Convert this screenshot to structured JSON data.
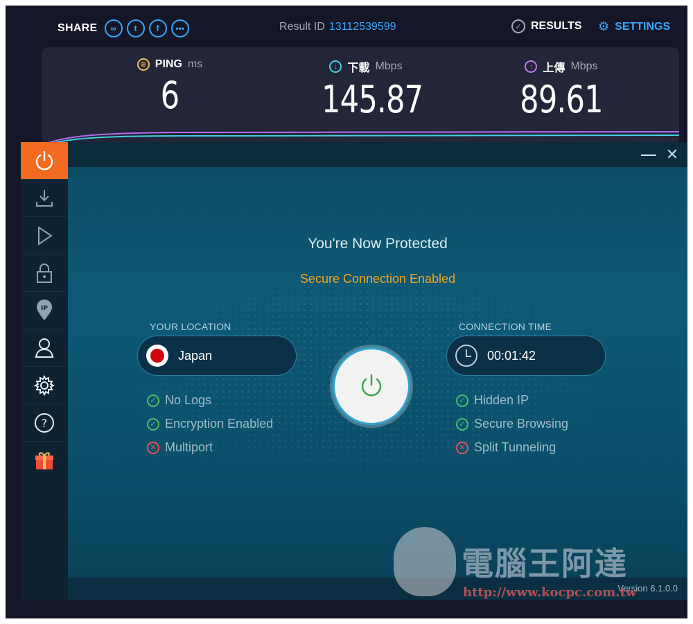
{
  "speedtest": {
    "share_label": "SHARE",
    "result_id_label": "Result ID",
    "result_id": "13112539599",
    "results_label": "RESULTS",
    "settings_label": "SETTINGS",
    "ping": {
      "label": "PING",
      "unit": "ms",
      "value": "6"
    },
    "download": {
      "label": "下載",
      "unit": "Mbps",
      "value": "145.87"
    },
    "upload": {
      "label": "上傳",
      "unit": "Mbps",
      "value": "89.61"
    }
  },
  "vpn": {
    "sidebar_icons": [
      "power-icon",
      "download-icon",
      "play-icon",
      "lock-icon",
      "ip-pin-icon",
      "user-icon",
      "gear-icon",
      "help-icon",
      "gift-icon"
    ],
    "headline": "You're Now Protected",
    "status": "Secure Connection Enabled",
    "location_label": "YOUR LOCATION",
    "location_value": "Japan",
    "time_label": "CONNECTION TIME",
    "time_value": "00:01:42",
    "left_features": [
      {
        "label": "No Logs",
        "enabled": true
      },
      {
        "label": "Encryption Enabled",
        "enabled": true
      },
      {
        "label": "Multiport",
        "enabled": false
      }
    ],
    "right_features": [
      {
        "label": "Hidden IP",
        "enabled": true
      },
      {
        "label": "Secure Browsing",
        "enabled": true
      },
      {
        "label": "Split Tunneling",
        "enabled": false
      }
    ],
    "version": "Version 6.1.0.0"
  },
  "watermark": {
    "text": "電腦王阿達",
    "url": "http://www.kocpc.com.tw"
  },
  "colors": {
    "accent_orange": "#f36b21",
    "status_yellow": "#f5a623",
    "speedtest_blue": "#3aa6ff"
  }
}
